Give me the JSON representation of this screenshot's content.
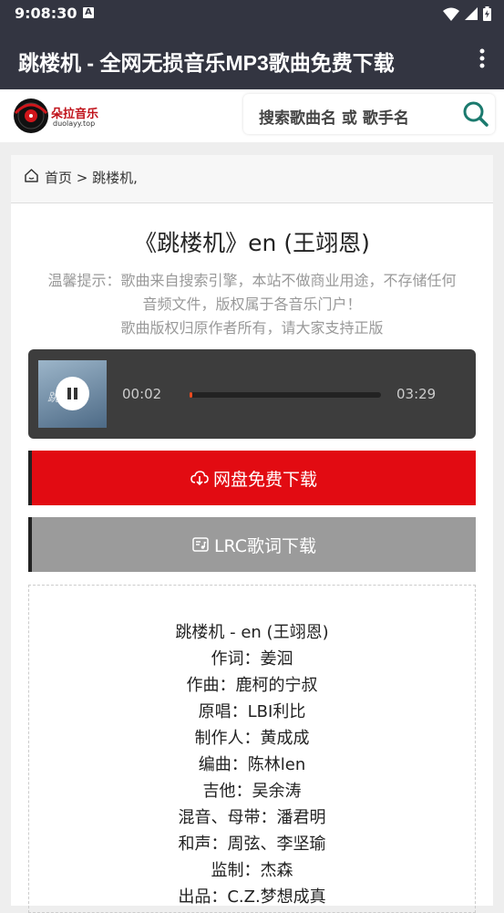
{
  "status_bar": {
    "time": "9:08:30",
    "notification_icon": "A"
  },
  "app_bar": {
    "title": "跳楼机 - 全网无损音乐MP3歌曲免费下载"
  },
  "header": {
    "logo_text": "朵拉音乐",
    "logo_subtext": "duolayy.top",
    "search_placeholder": "搜索歌曲名 或 歌手名"
  },
  "breadcrumb": {
    "home": "首页",
    "separator": ">",
    "current": "跳楼机,"
  },
  "song": {
    "title": "《跳楼机》en (王翊恩)",
    "tip_lines": [
      "温馨提示：歌曲来自搜索引擎，本站不做商业用途，不存储任何",
      "音频文件，版权属于各音乐门户！",
      "歌曲版权归原作者所有，请大家支持正版"
    ]
  },
  "player": {
    "current_time": "00:02",
    "duration": "03:29",
    "progress_fraction": 0.01,
    "cover_text": "跳楼机"
  },
  "buttons": {
    "download": "网盘免费下载",
    "lrc": "LRC歌词下载"
  },
  "lyrics": [
    "跳楼机 - en (王翊恩)",
    "作词：姜洄",
    "作曲：鹿柯的宁叔",
    "原唱：LBI利比",
    "制作人：黄成成",
    "编曲：陈林len",
    "吉他：吴余涛",
    "混音、母带：潘君明",
    "和声：周弦、李坚瑜",
    "监制：杰森",
    "出品：C.Z.梦想成真"
  ],
  "colors": {
    "app_bar": "#333541",
    "download_button": "#e20b12",
    "lrc_button": "#9b9b9b",
    "progress": "#e94a1f",
    "search_icon": "#1b7a6e"
  }
}
